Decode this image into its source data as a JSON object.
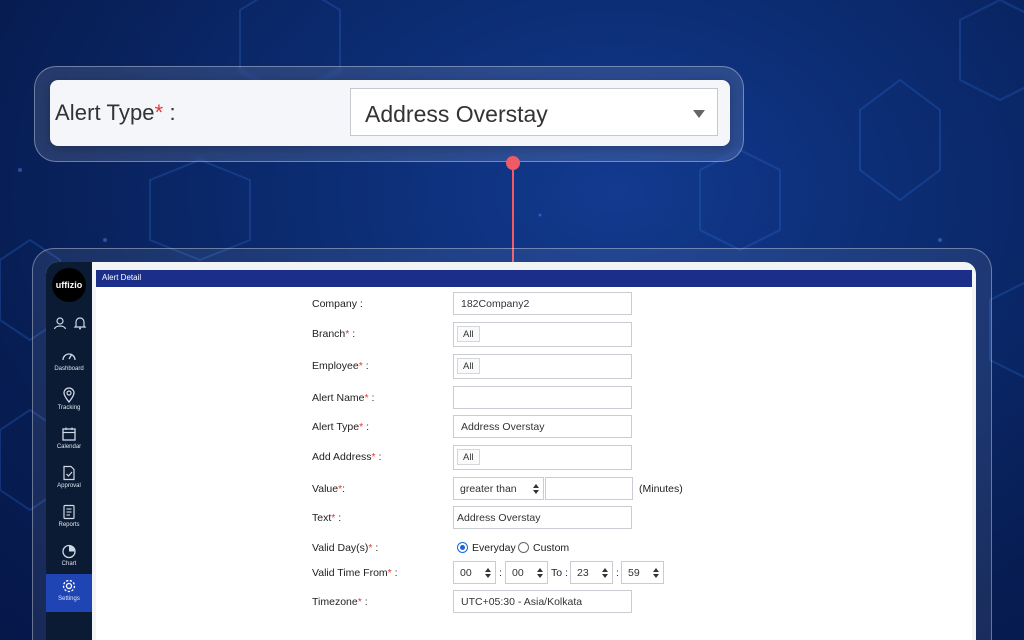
{
  "callout": {
    "label": "Alert Type",
    "required_mark": "*",
    "label_suffix": " :",
    "value": "Address Overstay"
  },
  "app": {
    "logo_text": "uffizio",
    "title": "Alert Detail",
    "sidebar": {
      "items": [
        {
          "label": "Dashboard",
          "icon": "gauge-icon"
        },
        {
          "label": "Tracking",
          "icon": "location-pin-icon"
        },
        {
          "label": "Calendar",
          "icon": "calendar-icon"
        },
        {
          "label": "Approval",
          "icon": "document-check-icon"
        },
        {
          "label": "Reports",
          "icon": "report-icon"
        },
        {
          "label": "Chart",
          "icon": "pie-chart-icon"
        },
        {
          "label": "Settings",
          "icon": "gear-icon",
          "active": true
        }
      ]
    },
    "form": {
      "company": {
        "label": "Company",
        "suffix": " :",
        "value": "182Company2"
      },
      "branch": {
        "label": "Branch",
        "suffix": " :",
        "chip": "All"
      },
      "employee": {
        "label": "Employee",
        "suffix": " :",
        "chip": "All"
      },
      "alert_name": {
        "label": "Alert Name",
        "suffix": " :",
        "value": ""
      },
      "alert_type": {
        "label": "Alert Type",
        "suffix": " :",
        "value": "Address Overstay"
      },
      "add_address": {
        "label": "Add Address",
        "suffix": " :",
        "chip": "All"
      },
      "value": {
        "label": "Value",
        "suffix": ":",
        "operator": "greater than",
        "amount": "",
        "unit": "(Minutes)"
      },
      "text": {
        "label": "Text",
        "suffix": " :",
        "value": "Address Overstay"
      },
      "valid_days": {
        "label": "Valid Day(s)",
        "suffix": " :",
        "option1": "Everyday",
        "option2": "Custom"
      },
      "valid_time": {
        "label": "Valid Time From",
        "suffix": " :",
        "from_h": "00",
        "from_m": "00",
        "to_label": "To :",
        "to_h": "23",
        "to_m": "59",
        "sep": ":"
      },
      "timezone": {
        "label": "Timezone",
        "suffix": " :",
        "value": "UTC+05:30 - Asia/Kolkata"
      },
      "required_mark": "*"
    }
  },
  "colors": {
    "accent": "#1f45b5",
    "titlebar": "#1b2f8a",
    "required": "#e53935",
    "connector": "#ef5a64"
  }
}
